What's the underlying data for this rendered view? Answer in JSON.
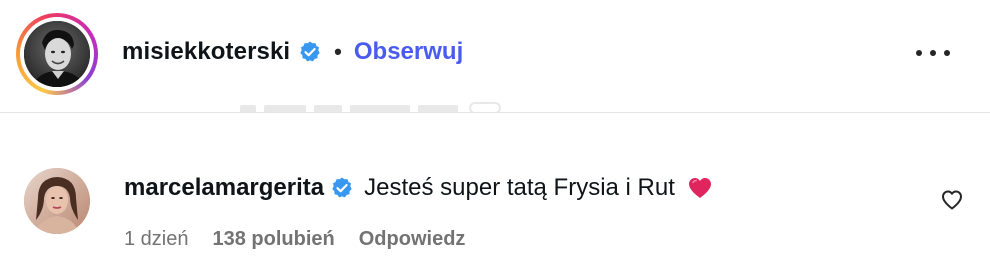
{
  "post_header": {
    "username": "misiekkoterski",
    "separator": "•",
    "follow_label": "Obserwuj",
    "icons": {
      "avatar": "profile-photo",
      "verified": "verified-badge-icon",
      "more": "more-options-icon"
    }
  },
  "comment": {
    "username": "marcelamargerita",
    "text": "Jesteś super tatą Frysia i Rut",
    "emoji": "red-heart",
    "time": "1 dzień",
    "likes": "138 polubień",
    "reply_label": "Odpowiedz",
    "icons": {
      "verified": "verified-badge-icon",
      "like": "heart-outline-icon"
    }
  },
  "colors": {
    "link": "#4a5cf0",
    "verified": "#3897f0",
    "muted": "#737373",
    "heart": "#e0245e"
  }
}
